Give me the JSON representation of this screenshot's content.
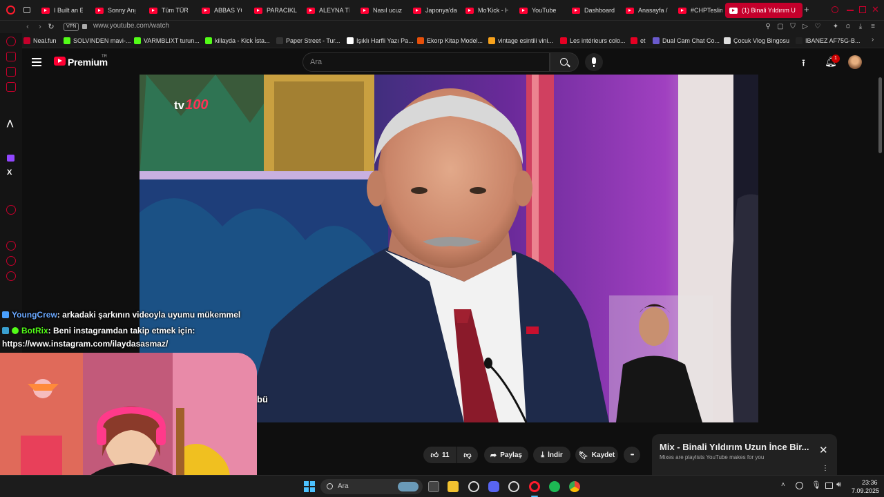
{
  "browser": {
    "tabs": [
      {
        "label": "I Built an En",
        "active": false
      },
      {
        "label": "Sonny Ange",
        "active": false
      },
      {
        "label": "Tüm TÜRK",
        "active": false
      },
      {
        "label": "ABBAS YOL",
        "active": false
      },
      {
        "label": "PARACIKLA",
        "active": false
      },
      {
        "label": "ALEYNA TİL",
        "active": false
      },
      {
        "label": "Nasıl ucuz t",
        "active": false
      },
      {
        "label": "Japonya'da",
        "active": false
      },
      {
        "label": "Mo'Kick - H",
        "active": false
      },
      {
        "label": "YouTube",
        "active": false
      },
      {
        "label": "Dashboard",
        "active": false
      },
      {
        "label": "Anasayfa / ",
        "active": false
      },
      {
        "label": "#CHPTeslim",
        "active": false
      },
      {
        "label": "(1) Binali Yıldırım U",
        "active": true
      }
    ],
    "new_tab": "+",
    "vpn_label": "VPN",
    "url": "www.youtube.com/watch",
    "bookmarks": [
      {
        "label": "Neal.fun",
        "color": "#c4002b"
      },
      {
        "label": "SOLVINDEN mavi-...",
        "color": "#53fc18"
      },
      {
        "label": "VARMBLIXT turun...",
        "color": "#53fc18"
      },
      {
        "label": "killayda - Kick İsta...",
        "color": "#53fc18"
      },
      {
        "label": "Paper Street - Tur...",
        "color": "#333333"
      },
      {
        "label": "Işıklı Harfli Yazı Pa...",
        "color": "#ffffff"
      },
      {
        "label": "Ekorp Kitap Model...",
        "color": "#e8500a"
      },
      {
        "label": "vintage esintili vini...",
        "color": "#f7a21c"
      },
      {
        "label": "Les intérieurs colo...",
        "color": "#e60023"
      },
      {
        "label": "et",
        "color": "#e60023"
      },
      {
        "label": "Dual Cam Chat Co...",
        "color": "#6a5acd"
      },
      {
        "label": "Çocuk Vlog Bingosu",
        "color": "#dddddd"
      },
      {
        "label": "IBANEZ AF75G-B...",
        "color": "#222222"
      }
    ]
  },
  "youtube": {
    "brand": "Premium",
    "region": "TR",
    "search_placeholder": "Ara",
    "notification_count": "1",
    "like_count": "11",
    "share_label": "Paylaş",
    "download_label": "İndir",
    "save_label": "Kaydet",
    "more_label": "•••",
    "mix_title": "Mix - Binali Yıldırım Uzun İnce Bir...",
    "mix_subtitle": "Mixes are playlists YouTube makes for you"
  },
  "video": {
    "channel_logo_text": "tv",
    "channel_logo_number": "100",
    "subtitle_fragment": "bü"
  },
  "chat": [
    {
      "user": "YoungCrew",
      "user_color": "#6aa8ff",
      "message": ": arkadaki şarkının videoyla uyumu mükemmel"
    },
    {
      "user": "BotRix",
      "user_color": "#53fc18",
      "message": ": Beni instagramdan takip etmek için:"
    },
    {
      "user": "",
      "user_color": "#ffffff",
      "message": "https://www.instagram.com/ilaydasasmaz/"
    }
  ],
  "taskbar": {
    "search_placeholder": "Ara",
    "time": "23:36",
    "date": "7.09.2025"
  }
}
